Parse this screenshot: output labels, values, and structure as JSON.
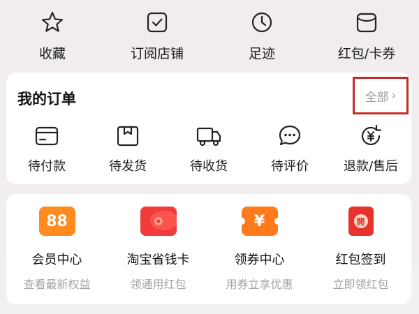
{
  "top_shortcuts": [
    {
      "label": "收藏",
      "icon": "star-icon"
    },
    {
      "label": "订阅店铺",
      "icon": "checkbox-icon"
    },
    {
      "label": "足迹",
      "icon": "clock-icon"
    },
    {
      "label": "红包/卡券",
      "icon": "coupon-icon"
    }
  ],
  "orders": {
    "title": "我的订单",
    "view_all": "全部",
    "items": [
      {
        "label": "待付款",
        "icon": "card-icon"
      },
      {
        "label": "待发货",
        "icon": "box-icon"
      },
      {
        "label": "待收货",
        "icon": "truck-icon"
      },
      {
        "label": "待评价",
        "icon": "chat-icon"
      },
      {
        "label": "退款/售后",
        "icon": "refund-icon"
      }
    ]
  },
  "benefits": [
    {
      "title": "会员中心",
      "subtitle": "查看最新权益",
      "icon_text": "88",
      "icon": "vip-88-icon"
    },
    {
      "title": "淘宝省钱卡",
      "subtitle": "领通用红包",
      "icon": "money-card-icon"
    },
    {
      "title": "领券中心",
      "subtitle": "用券立享优惠",
      "icon_text": "¥",
      "icon": "ticket-icon"
    },
    {
      "title": "红包签到",
      "subtitle": "立即领红包",
      "icon_text": "開",
      "icon": "red-envelope-icon"
    }
  ],
  "colors": {
    "accent_red": "#c42b2b",
    "orange": "#ff8a1f",
    "red": "#ee3b3b"
  }
}
